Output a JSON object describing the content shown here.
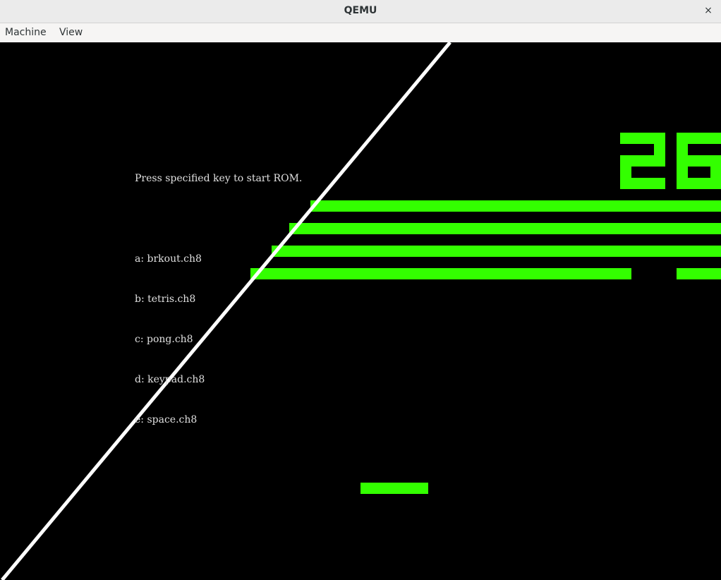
{
  "window": {
    "title": "QEMU",
    "close_glyph": "×"
  },
  "menubar": {
    "items": [
      {
        "label": "Machine"
      },
      {
        "label": "View"
      }
    ]
  },
  "console": {
    "prompt": "Press specified key to start ROM.",
    "roms": [
      "a: brkout.ch8",
      "b: tetris.ch8",
      "c: pong.ch8",
      "d: keypad.ch8",
      "e: space.ch8"
    ]
  },
  "game": {
    "score": "26",
    "colors": {
      "pixel": "#33ff00",
      "background": "#000000",
      "divider": "#ffffff",
      "text": "#e0e0e0"
    }
  }
}
